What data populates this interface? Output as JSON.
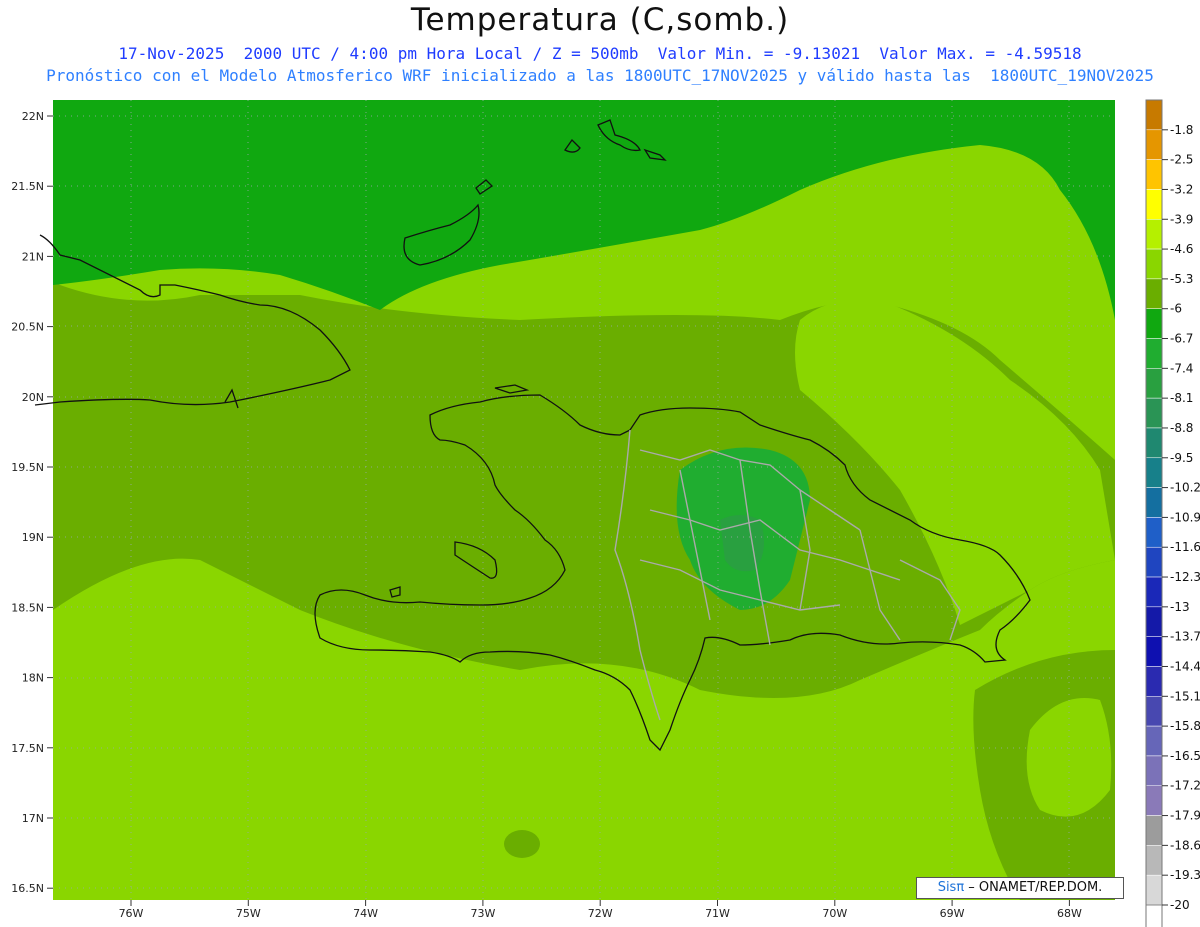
{
  "header": {
    "title": "Temperatura (C,somb.)",
    "line1": "17-Nov-2025  2000 UTC / 4:00 pm Hora Local / Z = 500mb  Valor Min. = -9.13021  Valor Max. = -4.59518",
    "line2": "Pronóstico con el Modelo Atmosferico WRF inicializado a las 1800UTC_17NOV2025 y válido hasta las  1800UTC_19NOV2025"
  },
  "axes": {
    "lat_labels": [
      "22N",
      "21.5N",
      "21N",
      "20.5N",
      "20N",
      "19.5N",
      "19N",
      "18.5N",
      "18N",
      "17.5N",
      "17N",
      "16.5N"
    ],
    "lon_labels": [
      "76W",
      "75W",
      "74W",
      "73W",
      "72W",
      "71W",
      "70W",
      "69W",
      "68W"
    ]
  },
  "colorbar": {
    "levels": [
      "-1.8",
      "-2.5",
      "-3.2",
      "-3.9",
      "-4.6",
      "-5.3",
      "-6",
      "-6.7",
      "-7.4",
      "-8.1",
      "-8.8",
      "-9.5",
      "-10.2",
      "-10.9",
      "-11.6",
      "-12.3",
      "-13",
      "-13.7",
      "-14.4",
      "-15.1",
      "-15.8",
      "-16.5",
      "-17.2",
      "-17.9",
      "-18.6",
      "-19.3",
      "-20"
    ],
    "colors": [
      "#c77a00",
      "#e59600",
      "#ffc400",
      "#ffff00",
      "#b5f000",
      "#8ad600",
      "#6aae00",
      "#10a810",
      "#20ad30",
      "#29a040",
      "#2a9455",
      "#1f8870",
      "#17808a",
      "#146fa0",
      "#1f5fc8",
      "#1f45c0",
      "#1a28b8",
      "#1419a8",
      "#0e10b0",
      "#2a2ab0",
      "#4848b0",
      "#6666b8",
      "#7b72b8",
      "#8a7ab8",
      "#9c9c9c",
      "#b8b8b8",
      "#d8d8d8"
    ]
  },
  "legend_credit": {
    "brand": "Sisπ",
    "text": " – ONAMET/REP.DOM."
  }
}
